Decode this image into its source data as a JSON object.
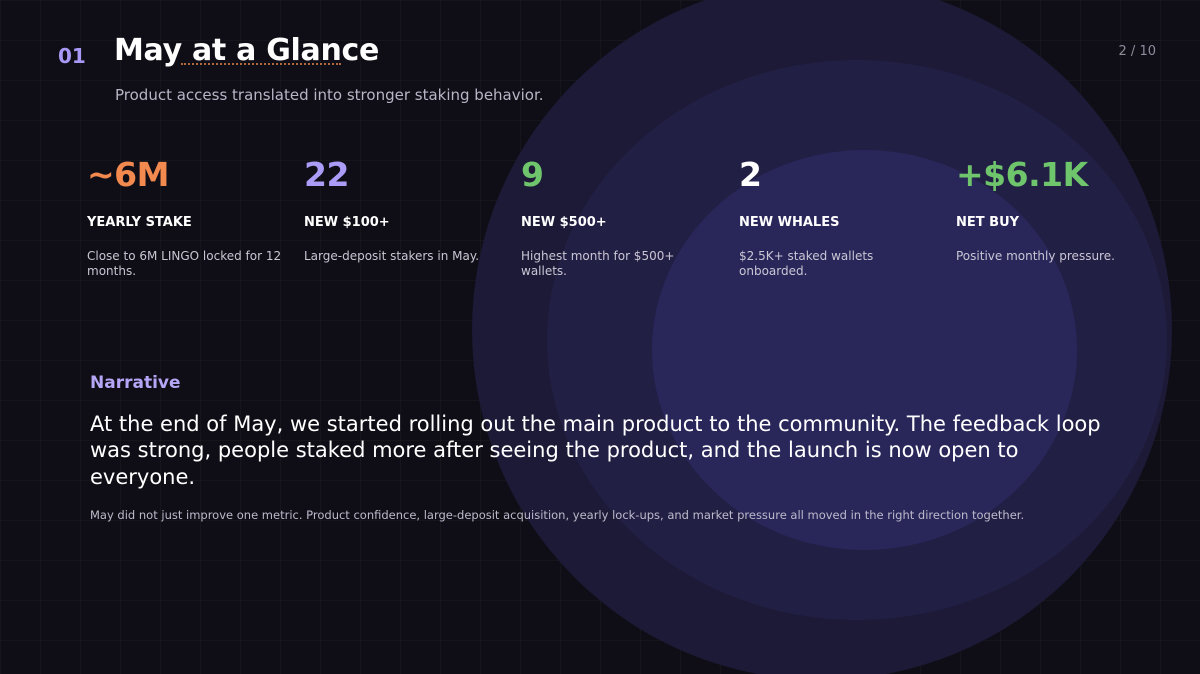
{
  "header": {
    "section_number": "01",
    "title": "May at a Glance",
    "subtitle": "Product access translated into stronger staking behavior.",
    "page_indicator": "2 / 10"
  },
  "metrics": [
    {
      "value": "~6M",
      "label": "YEARLY STAKE",
      "description": "Close to 6M LINGO locked for 12 months.",
      "color": "#f2894f"
    },
    {
      "value": "22",
      "label": "NEW $100+",
      "description": "Large-deposit stakers in May.",
      "color": "#ab9cf8"
    },
    {
      "value": "9",
      "label": "NEW $500+",
      "description": "Highest month for $500+ wallets.",
      "color": "#6fc56b"
    },
    {
      "value": "2",
      "label": "NEW WHALES",
      "description": "$2.5K+ staked wallets onboarded.",
      "color": "#ffffff"
    },
    {
      "value": "+$6.1K",
      "label": "NET BUY",
      "description": "Positive monthly pressure.",
      "color": "#6fc56b"
    }
  ],
  "narrative": {
    "label": "Narrative",
    "body": "At the end of May, we started rolling out the main product to the community. The feedback loop was strong, people staked more after seeing the product, and the launch is now open to everyone.",
    "footnote": "May did not just improve one metric. Product confidence, large-deposit acquisition, yearly lock-ups, and market pressure all moved in the right direction together."
  }
}
